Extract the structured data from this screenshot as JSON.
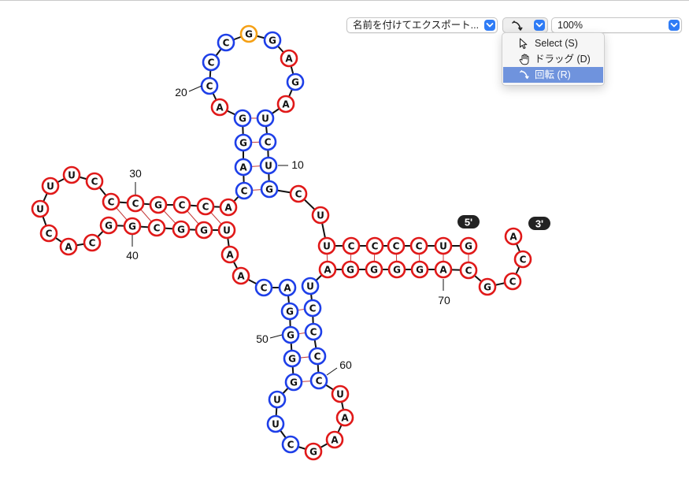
{
  "toolbar": {
    "export_select": {
      "label": "名前を付けてエクスポート..."
    },
    "tool_button": {
      "icon": "rotate-arrow-icon"
    },
    "zoom_select": {
      "value": "100%"
    },
    "colors": {
      "accent": "#2f7cf6"
    }
  },
  "tool_menu": {
    "items": [
      {
        "label": "Select (S)",
        "icon": "pointer-icon",
        "selected": false
      },
      {
        "label": "ドラッグ (D)",
        "icon": "hand-icon",
        "selected": false
      },
      {
        "label": "回転 (R)",
        "icon": "rotate-arrow-icon",
        "selected": true
      }
    ]
  },
  "diagram": {
    "colors": {
      "red": "#e01919",
      "blue": "#1e3fe8",
      "orange": "#f5a015",
      "pair_line": "#c43a3a",
      "backbone": "#111111"
    },
    "nucleotides": [
      {
        "n": 1,
        "b": "G",
        "c": "red"
      },
      {
        "n": 2,
        "b": "U",
        "c": "red"
      },
      {
        "n": 3,
        "b": "C",
        "c": "red"
      },
      {
        "n": 4,
        "b": "C",
        "c": "red"
      },
      {
        "n": 5,
        "b": "C",
        "c": "red"
      },
      {
        "n": 6,
        "b": "C",
        "c": "red"
      },
      {
        "n": 7,
        "b": "U",
        "c": "red"
      },
      {
        "n": 8,
        "b": "U",
        "c": "red"
      },
      {
        "n": 9,
        "b": "C",
        "c": "red"
      },
      {
        "n": 10,
        "b": "G",
        "c": "blue"
      },
      {
        "n": 11,
        "b": "U",
        "c": "blue"
      },
      {
        "n": 12,
        "b": "C",
        "c": "blue"
      },
      {
        "n": 13,
        "b": "U",
        "c": "blue"
      },
      {
        "n": 14,
        "b": "A",
        "c": "red"
      },
      {
        "n": 15,
        "b": "G",
        "c": "blue"
      },
      {
        "n": 16,
        "b": "A",
        "c": "red"
      },
      {
        "n": 17,
        "b": "G",
        "c": "blue"
      },
      {
        "n": 18,
        "b": "G",
        "c": "orange"
      },
      {
        "n": 19,
        "b": "C",
        "c": "blue"
      },
      {
        "n": 20,
        "b": "C",
        "c": "blue"
      },
      {
        "n": 21,
        "b": "C",
        "c": "blue"
      },
      {
        "n": 22,
        "b": "A",
        "c": "red"
      },
      {
        "n": 23,
        "b": "G",
        "c": "blue"
      },
      {
        "n": 24,
        "b": "G",
        "c": "blue"
      },
      {
        "n": 25,
        "b": "A",
        "c": "blue"
      },
      {
        "n": 26,
        "b": "C",
        "c": "blue"
      },
      {
        "n": 27,
        "b": "A",
        "c": "red"
      },
      {
        "n": 28,
        "b": "C",
        "c": "red"
      },
      {
        "n": 29,
        "b": "C",
        "c": "red"
      },
      {
        "n": 30,
        "b": "G",
        "c": "red"
      },
      {
        "n": 31,
        "b": "C",
        "c": "red"
      },
      {
        "n": 32,
        "b": "C",
        "c": "red"
      },
      {
        "n": 33,
        "b": "C",
        "c": "red"
      },
      {
        "n": 34,
        "b": "U",
        "c": "red"
      },
      {
        "n": 35,
        "b": "U",
        "c": "red"
      },
      {
        "n": 36,
        "b": "U",
        "c": "red"
      },
      {
        "n": 37,
        "b": "C",
        "c": "red"
      },
      {
        "n": 38,
        "b": "A",
        "c": "red"
      },
      {
        "n": 39,
        "b": "C",
        "c": "red"
      },
      {
        "n": 40,
        "b": "G",
        "c": "red"
      },
      {
        "n": 41,
        "b": "G",
        "c": "red"
      },
      {
        "n": 42,
        "b": "C",
        "c": "red"
      },
      {
        "n": 43,
        "b": "G",
        "c": "red"
      },
      {
        "n": 44,
        "b": "G",
        "c": "red"
      },
      {
        "n": 45,
        "b": "U",
        "c": "red"
      },
      {
        "n": 46,
        "b": "A",
        "c": "red"
      },
      {
        "n": 47,
        "b": "A",
        "c": "red"
      },
      {
        "n": 48,
        "b": "C",
        "c": "blue"
      },
      {
        "n": 49,
        "b": "A",
        "c": "blue"
      },
      {
        "n": 50,
        "b": "G",
        "c": "blue"
      },
      {
        "n": 51,
        "b": "G",
        "c": "blue"
      },
      {
        "n": 52,
        "b": "G",
        "c": "blue"
      },
      {
        "n": 53,
        "b": "G",
        "c": "blue"
      },
      {
        "n": 54,
        "b": "U",
        "c": "blue"
      },
      {
        "n": 55,
        "b": "U",
        "c": "blue"
      },
      {
        "n": 56,
        "b": "C",
        "c": "blue"
      },
      {
        "n": 57,
        "b": "G",
        "c": "red"
      },
      {
        "n": 58,
        "b": "A",
        "c": "red"
      },
      {
        "n": 59,
        "b": "A",
        "c": "red"
      },
      {
        "n": 60,
        "b": "U",
        "c": "red"
      },
      {
        "n": 61,
        "b": "C",
        "c": "blue"
      },
      {
        "n": 62,
        "b": "C",
        "c": "blue"
      },
      {
        "n": 63,
        "b": "C",
        "c": "blue"
      },
      {
        "n": 64,
        "b": "C",
        "c": "blue"
      },
      {
        "n": 65,
        "b": "U",
        "c": "blue"
      },
      {
        "n": 66,
        "b": "A",
        "c": "red"
      },
      {
        "n": 67,
        "b": "G",
        "c": "red"
      },
      {
        "n": 68,
        "b": "G",
        "c": "red"
      },
      {
        "n": 69,
        "b": "G",
        "c": "red"
      },
      {
        "n": 70,
        "b": "G",
        "c": "red"
      },
      {
        "n": 71,
        "b": "A",
        "c": "red"
      },
      {
        "n": 72,
        "b": "C",
        "c": "red"
      },
      {
        "n": 73,
        "b": "G",
        "c": "red"
      },
      {
        "n": 74,
        "b": "C",
        "c": "red"
      },
      {
        "n": 75,
        "b": "C",
        "c": "red"
      },
      {
        "n": 76,
        "b": "A",
        "c": "red"
      }
    ],
    "pairs": [
      [
        1,
        72
      ],
      [
        2,
        71
      ],
      [
        3,
        70
      ],
      [
        4,
        69
      ],
      [
        5,
        68
      ],
      [
        6,
        67
      ],
      [
        7,
        66
      ],
      [
        10,
        26
      ],
      [
        11,
        25
      ],
      [
        12,
        24
      ],
      [
        13,
        23
      ],
      [
        28,
        45
      ],
      [
        29,
        44
      ],
      [
        30,
        43
      ],
      [
        31,
        42
      ],
      [
        32,
        41
      ],
      [
        50,
        64
      ],
      [
        51,
        63
      ],
      [
        52,
        62
      ],
      [
        53,
        61
      ]
    ],
    "position_labels": [
      "10",
      "20",
      "30",
      "40",
      "50",
      "60",
      "70"
    ],
    "end_labels": {
      "five": "5'",
      "three": "3'"
    }
  }
}
